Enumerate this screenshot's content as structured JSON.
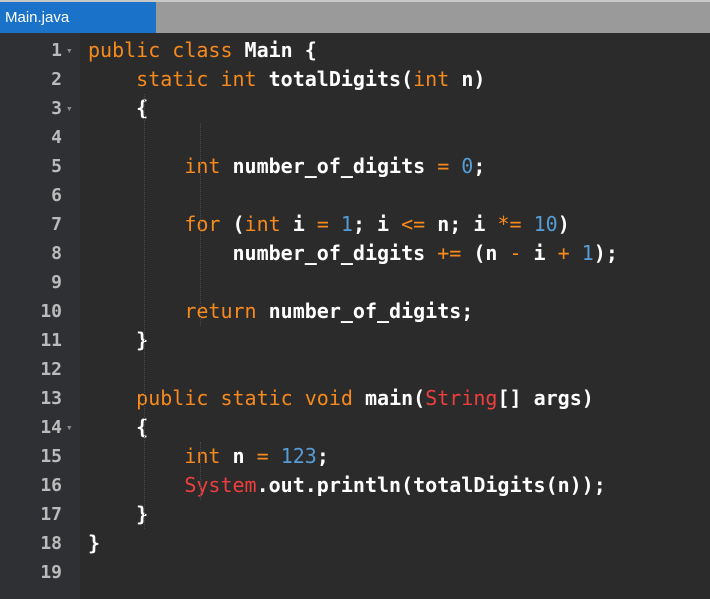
{
  "tab": {
    "label": "Main.java"
  },
  "lines": [
    {
      "n": "1",
      "fold": true,
      "tokens": [
        [
          "kw",
          "public "
        ],
        [
          "kw",
          "class "
        ],
        [
          "p",
          "Main {"
        ]
      ]
    },
    {
      "n": "2",
      "fold": false,
      "tokens": [
        [
          "p",
          "    "
        ],
        [
          "kw",
          "static "
        ],
        [
          "kw",
          "int "
        ],
        [
          "p",
          "totalDigits("
        ],
        [
          "kw",
          "int "
        ],
        [
          "p",
          "n)"
        ]
      ]
    },
    {
      "n": "3",
      "fold": true,
      "tokens": [
        [
          "p",
          "    {"
        ]
      ]
    },
    {
      "n": "4",
      "fold": false,
      "tokens": []
    },
    {
      "n": "5",
      "fold": false,
      "tokens": [
        [
          "p",
          "        "
        ],
        [
          "kw",
          "int "
        ],
        [
          "p",
          "number_of_digits "
        ],
        [
          "op",
          "="
        ],
        [
          "p",
          " "
        ],
        [
          "num",
          "0"
        ],
        [
          "p",
          ";"
        ]
      ]
    },
    {
      "n": "6",
      "fold": false,
      "tokens": []
    },
    {
      "n": "7",
      "fold": false,
      "tokens": [
        [
          "p",
          "        "
        ],
        [
          "kw",
          "for "
        ],
        [
          "p",
          "("
        ],
        [
          "kw",
          "int "
        ],
        [
          "p",
          "i "
        ],
        [
          "op",
          "="
        ],
        [
          "p",
          " "
        ],
        [
          "num",
          "1"
        ],
        [
          "p",
          "; i "
        ],
        [
          "op",
          "<="
        ],
        [
          "p",
          " n; i "
        ],
        [
          "op",
          "*="
        ],
        [
          "p",
          " "
        ],
        [
          "num",
          "10"
        ],
        [
          "p",
          ")"
        ]
      ]
    },
    {
      "n": "8",
      "fold": false,
      "tokens": [
        [
          "p",
          "            number_of_digits "
        ],
        [
          "op",
          "+="
        ],
        [
          "p",
          " (n "
        ],
        [
          "op",
          "-"
        ],
        [
          "p",
          " i "
        ],
        [
          "op",
          "+"
        ],
        [
          "p",
          " "
        ],
        [
          "num",
          "1"
        ],
        [
          "p",
          ");"
        ]
      ]
    },
    {
      "n": "9",
      "fold": false,
      "tokens": []
    },
    {
      "n": "10",
      "fold": false,
      "tokens": [
        [
          "p",
          "        "
        ],
        [
          "kw",
          "return "
        ],
        [
          "p",
          "number_of_digits;"
        ]
      ]
    },
    {
      "n": "11",
      "fold": false,
      "tokens": [
        [
          "p",
          "    }"
        ]
      ]
    },
    {
      "n": "12",
      "fold": false,
      "tokens": []
    },
    {
      "n": "13",
      "fold": false,
      "tokens": [
        [
          "p",
          "    "
        ],
        [
          "kw",
          "public "
        ],
        [
          "kw",
          "static "
        ],
        [
          "kw",
          "void "
        ],
        [
          "p",
          "main("
        ],
        [
          "cls",
          "String"
        ],
        [
          "p",
          "[] args)"
        ]
      ]
    },
    {
      "n": "14",
      "fold": true,
      "tokens": [
        [
          "p",
          "    {"
        ]
      ]
    },
    {
      "n": "15",
      "fold": false,
      "tokens": [
        [
          "p",
          "        "
        ],
        [
          "kw",
          "int "
        ],
        [
          "p",
          "n "
        ],
        [
          "op",
          "="
        ],
        [
          "p",
          " "
        ],
        [
          "num",
          "123"
        ],
        [
          "p",
          ";"
        ]
      ]
    },
    {
      "n": "16",
      "fold": false,
      "tokens": [
        [
          "p",
          "        "
        ],
        [
          "cls",
          "System"
        ],
        [
          "p",
          ".out.println(totalDigits(n));"
        ]
      ]
    },
    {
      "n": "17",
      "fold": false,
      "tokens": [
        [
          "p",
          "    }"
        ]
      ]
    },
    {
      "n": "18",
      "fold": false,
      "tokens": [
        [
          "p",
          "}"
        ]
      ]
    },
    {
      "n": "19",
      "fold": false,
      "tokens": []
    }
  ]
}
